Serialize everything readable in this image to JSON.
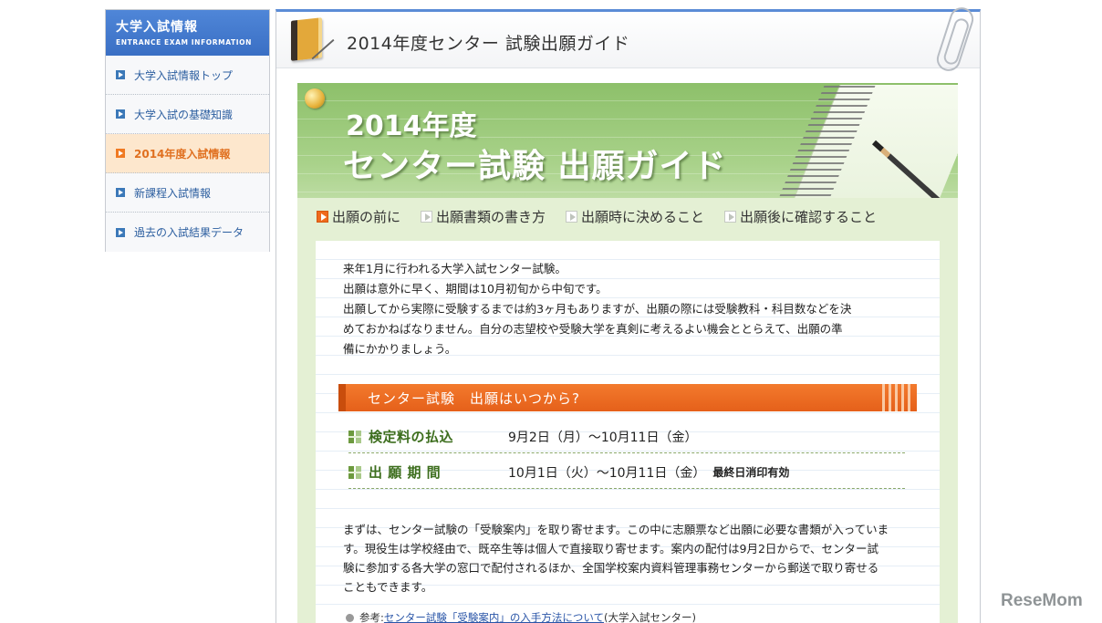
{
  "sidebar": {
    "title": "大学入試情報",
    "subtitle": "ENTRANCE EXAM INFORMATION",
    "items": [
      {
        "label": "大学入試情報トップ"
      },
      {
        "label": "大学入試の基礎知識"
      },
      {
        "label": "2014年度入試情報"
      },
      {
        "label": "新課程入試情報"
      },
      {
        "label": "過去の入試結果データ"
      }
    ],
    "active_index": 2
  },
  "header": {
    "title": "2014年度センター 試験出願ガイド"
  },
  "banner": {
    "line1": "2014年度",
    "line2": "センター試験 出願ガイド"
  },
  "tabs": [
    {
      "label": "出願の前に"
    },
    {
      "label": "出願書類の書き方"
    },
    {
      "label": "出願時に決めること"
    },
    {
      "label": "出願後に確認すること"
    }
  ],
  "intro": [
    "来年1月に行われる大学入試センター試験。",
    "出願は意外に早く、期間は10月初旬から中旬です。",
    "出願してから実際に受験するまでは約3ヶ月もありますが、出願の際には受験教科・科目数などを決",
    "めておかねばなりません。自分の志望校や受験大学を真剣に考えるよい機会ととらえて、出願の準",
    "備にかかりましょう。"
  ],
  "section": {
    "heading": "センター試験　出願はいつから?"
  },
  "schedule": [
    {
      "label": "検定料の払込",
      "value": "9月2日（月）～10月11日（金）",
      "note": ""
    },
    {
      "label": "出 願 期 間",
      "value": "10月1日（火）～10月11日（金）",
      "note": "最終日消印有効"
    }
  ],
  "body": [
    "まずは、センター試験の「受験案内」を取り寄せます。この中に志願票など出願に必要な書類が入っていま",
    "す。現役生は学校経由で、既卒生等は個人で直接取り寄せます。案内の配付は9月2日からで、センター試",
    "験に参加する各大学の窓口で配付されるほか、全国学校案内資料管理事務センターから郵送で取り寄せる",
    "こともできます。"
  ],
  "reference": {
    "prefix": "参考:",
    "link": "センター試験「受験案内」の入手方法について",
    "suffix": "(大学入試センター)"
  },
  "watermark": "ReseMom",
  "colors": {
    "sidebar_header": "#3a6fc4",
    "active_orange": "#f07a22",
    "section_orange": "#e5601a",
    "label_green": "#3d6e1e"
  }
}
